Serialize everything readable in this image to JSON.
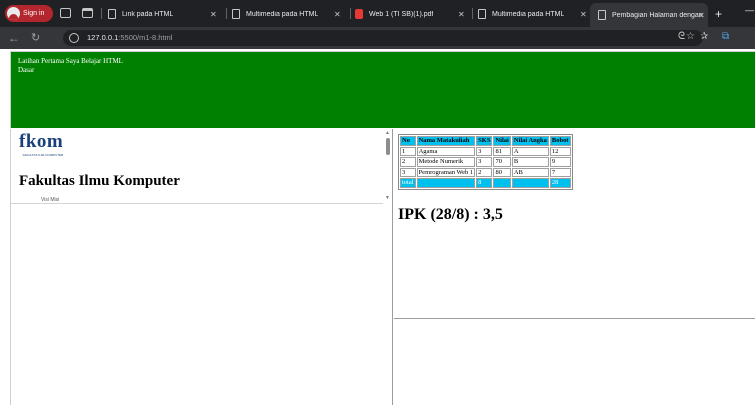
{
  "browser": {
    "signin_label": "Sign in",
    "tabs": [
      {
        "title": "Link pada HTML",
        "type": "page"
      },
      {
        "title": "Multimedia pada HTML",
        "type": "page"
      },
      {
        "title": "Web 1 (TI SB)(1).pdf",
        "type": "pdf"
      },
      {
        "title": "Multimedia pada HTML",
        "type": "page"
      },
      {
        "title": "Pembagian Halaman dengan F",
        "type": "page",
        "active": true
      }
    ],
    "url_host": "127.0.0.1",
    "url_rest": ":5500/m1-8.html"
  },
  "header_frame": {
    "line1": "Latihan Pertama Saya Belajar HTML",
    "line2": "Dasar",
    "bg_color": "#008000"
  },
  "left_frame": {
    "logo_text": "fkom",
    "logo_subtext": "FAKULTAS ILMU KOMPUTER",
    "title": "Fakultas Ilmu Komputer",
    "cut_text": "Visi Misi"
  },
  "grades": {
    "headers": [
      "No",
      "Nama Matakuliah",
      "SKS",
      "Nilai",
      "Nilai Angka",
      "Bobot"
    ],
    "rows": [
      [
        "1",
        "Agama",
        "3",
        "81",
        "A",
        "12"
      ],
      [
        "2",
        "Metode Numerik",
        "3",
        "70",
        "B",
        "9"
      ],
      [
        "3",
        "Pemrograman Web 1",
        "2",
        "80",
        "AB",
        "7"
      ]
    ],
    "total": [
      "total",
      "",
      "8",
      "",
      "",
      "28"
    ],
    "header_color": "#00c0f0"
  },
  "ipk_text": "IPK (28/8) : 3,5"
}
